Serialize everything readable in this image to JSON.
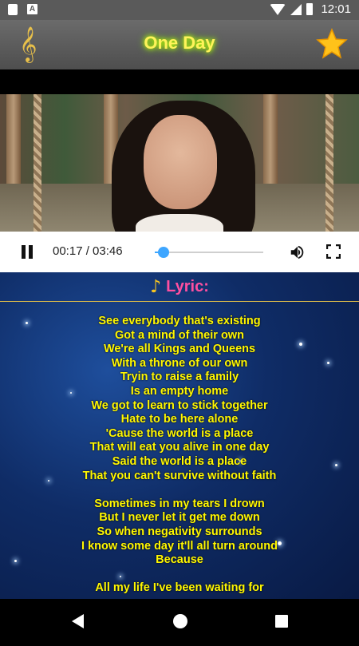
{
  "status_bar": {
    "time": "12:01",
    "icons": [
      "sd-card-icon",
      "a-notification-icon",
      "wifi-icon",
      "signal-icon",
      "battery-icon"
    ]
  },
  "app_bar": {
    "title": "One Day",
    "left_icon": "treble-clef-icon",
    "right_icon": "favorite-star-icon",
    "title_color": "#fff35a"
  },
  "video": {
    "content": "video-thumbnail",
    "progress": 0.078
  },
  "player": {
    "time_display": "00:17 / 03:46",
    "accent_color": "#3ea6ff",
    "icons": [
      "pause-icon",
      "volume-icon",
      "fullscreen-icon"
    ]
  },
  "lyrics": {
    "heading": "Lyric:",
    "heading_color": "#ff4fa0",
    "text_color": "#fff700",
    "lines": [
      "See everybody that's existing",
      "Got a mind of their own",
      "We're all Kings and Queens",
      "With a throne of our own",
      "Tryin to raise a family",
      "Is an empty home",
      "We got to learn to stick together",
      "Hate to be here alone",
      "'Cause the world is a place",
      "That will eat you alive in one day",
      "Said the world is a place",
      "That you can't survive without faith",
      "",
      "Sometimes in my tears I drown",
      "But I never let it get me down",
      "So when negativity surrounds",
      "I know some day it'll all turn around",
      "Because",
      "",
      "All my life I've been waiting for"
    ]
  },
  "nav_bar": {
    "icons": [
      "back-icon",
      "home-icon",
      "recents-icon"
    ]
  }
}
